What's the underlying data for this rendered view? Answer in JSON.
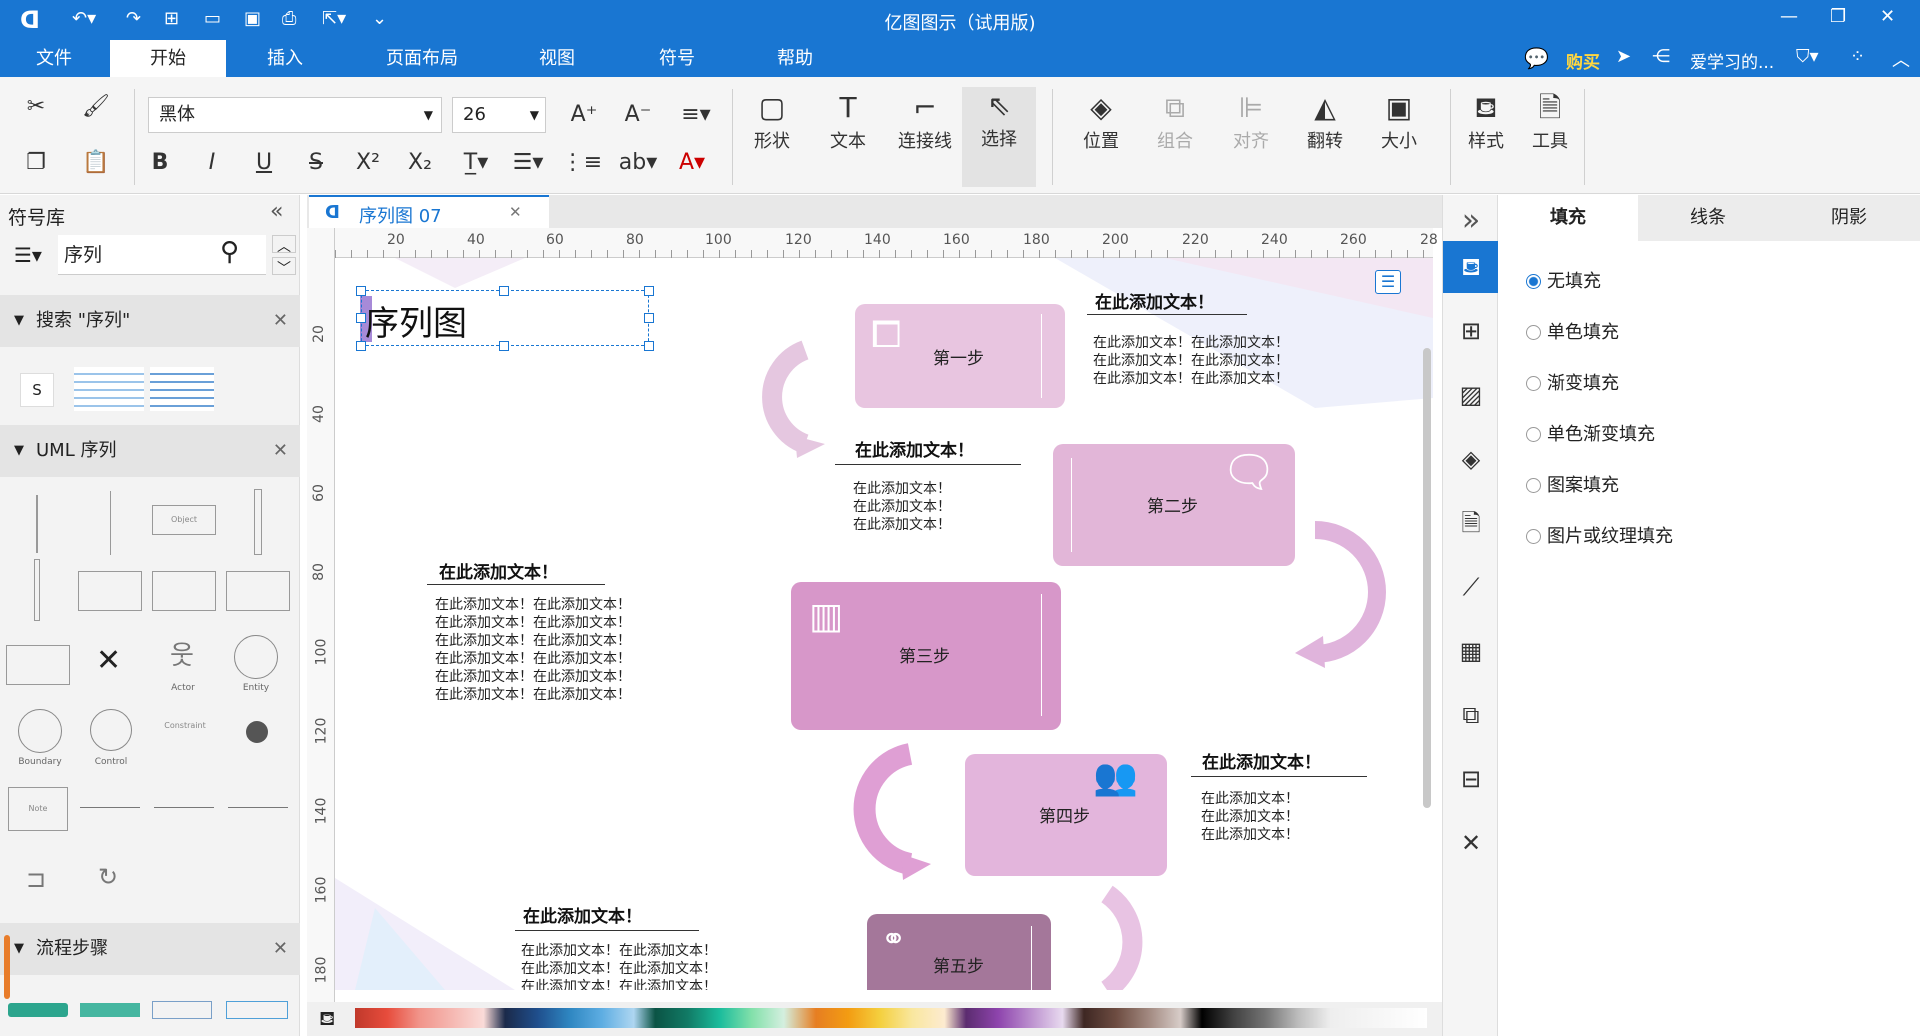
{
  "app": {
    "title": "亿图图示（试用版)"
  },
  "menu": {
    "items": [
      "文件",
      "开始",
      "插入",
      "页面布局",
      "视图",
      "符号",
      "帮助"
    ],
    "active": "开始"
  },
  "titlebar_right": {
    "buy": "购买",
    "user": "爱学习的..."
  },
  "ribbon": {
    "font_name": "黑体",
    "font_size": "26",
    "buttons": {
      "shape": "形状",
      "text": "文本",
      "connector": "连接线",
      "select": "选择",
      "position": "位置",
      "group": "组合",
      "align": "对齐",
      "flip": "翻转",
      "size": "大小",
      "style": "样式",
      "tools": "工具"
    }
  },
  "left_panel": {
    "title": "符号库",
    "search_value": "序列",
    "sections": [
      {
        "label": "搜索 \"序列\""
      },
      {
        "label": "UML 序列"
      },
      {
        "label": "流程步骤"
      }
    ],
    "uml_labels": {
      "object": "Object",
      "actor": "Actor",
      "entity": "Entity",
      "boundary": "Boundary",
      "control": "Control",
      "constraint": "Constraint",
      "note": "Note"
    },
    "search_s": "S"
  },
  "document": {
    "tab_label": "序列图 07"
  },
  "rulers": {
    "h_ticks": [
      "20",
      "40",
      "60",
      "80",
      "100",
      "120",
      "140",
      "160",
      "180",
      "200",
      "220",
      "240",
      "260",
      "28"
    ],
    "v_ticks": [
      "20",
      "40",
      "60",
      "80",
      "100",
      "120",
      "140",
      "160",
      "180"
    ]
  },
  "canvas": {
    "title": "序列图",
    "steps": [
      "第一步",
      "第二步",
      "第三步",
      "第四步",
      "第五步"
    ],
    "note_title": "在此添加文本！",
    "note_short": "在此添加文本！\n在此添加文本！\n在此添加文本！",
    "note_wide3": "在此添加文本！在此添加文本！\n在此添加文本！在此添加文本！\n在此添加文本！在此添加文本！",
    "note_wide6": "在此添加文本！在此添加文本！\n在此添加文本！在此添加文本！\n在此添加文本！在此添加文本！\n在此添加文本！在此添加文本！\n在此添加文本！在此添加文本！\n在此添加文本！在此添加文本！"
  },
  "right_panel": {
    "tabs": [
      "填充",
      "线条",
      "阴影"
    ],
    "active_tab": "填充",
    "options": [
      "无填充",
      "单色填充",
      "渐变填充",
      "单色渐变填充",
      "图案填充",
      "图片或纹理填充"
    ],
    "selected": "无填充"
  },
  "colors": {
    "accent": "#1976d2",
    "step1": "#e8c5e0",
    "step2": "#e2b6d8",
    "step3": "#d797c9",
    "step4": "#e3b5dc",
    "step5": "#a4779a"
  }
}
